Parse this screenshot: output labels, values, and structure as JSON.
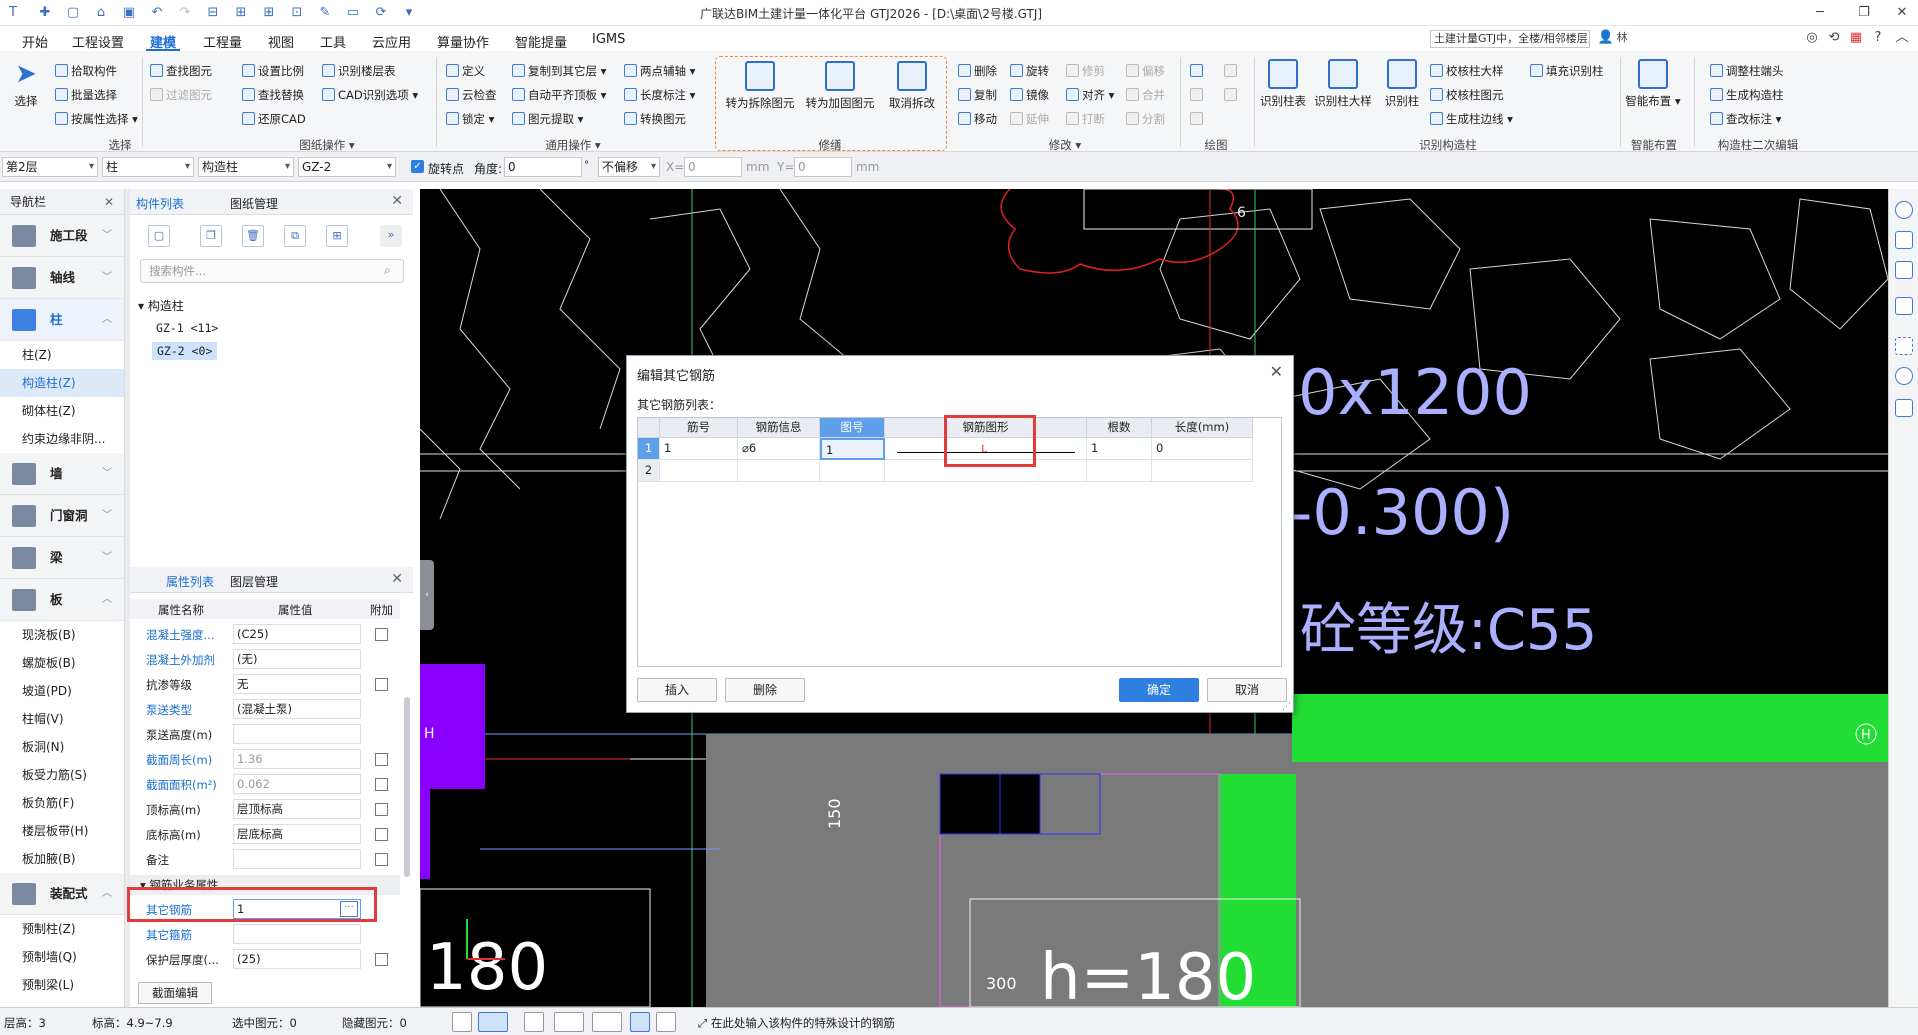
{
  "titlebar": {
    "title": "广联达BIM土建计量一体化平台 GTJ2026 - [D:\\桌面\\2号楼.GTJ]",
    "search_text": "土建计量GTJ中，全楼/相邻楼层三维显示图元/轴网有错",
    "user": "林"
  },
  "menu": {
    "items": [
      "开始",
      "工程设置",
      "建模",
      "工程量",
      "视图",
      "工具",
      "云应用",
      "算量协作",
      "智能提量",
      "IGMS"
    ]
  },
  "ribbon": {
    "select": {
      "big": "选择",
      "items": [
        "拾取构件",
        "批量选择",
        "按属性选择"
      ],
      "group": "选择"
    },
    "drawing_ops": {
      "items": [
        "查找图元",
        "过滤图元",
        "设置比例",
        "查找替换",
        "还原CAD",
        "识别楼层表",
        "CAD识别选项"
      ],
      "group": "图纸操作"
    },
    "common_ops": {
      "items": [
        "定义",
        "云检查",
        "锁定",
        "复制到其它层",
        "自动平齐顶板",
        "图元提取",
        "两点辅轴",
        "长度标注",
        "转换图元"
      ],
      "group": "通用操作"
    },
    "modify_special": {
      "items": [
        "转为拆除图元",
        "转为加固图元",
        "取消拆改"
      ],
      "group": "修缮"
    },
    "modify": {
      "items": [
        "删除",
        "旋转",
        "修剪",
        "偏移",
        "复制",
        "镜像",
        "对齐",
        "合并",
        "移动",
        "延伸",
        "打断",
        "分割"
      ],
      "group": "修改"
    },
    "draw": {
      "group": "绘图"
    },
    "recognize_col": {
      "big": [
        "识别柱表",
        "识别柱大样",
        "识别柱"
      ],
      "items": [
        "校核柱大样",
        "填充识别柱",
        "校核柱图元",
        "生成柱边线"
      ],
      "group": "识别构造柱"
    },
    "smart": {
      "big": "智能布置",
      "group": "智能布置"
    },
    "secondary": {
      "items": [
        "调整柱端头",
        "生成构造柱",
        "查改标注"
      ],
      "group": "构造柱二次编辑"
    }
  },
  "propbar": {
    "floor": "第2层",
    "type": "柱",
    "subtype": "构造柱",
    "comp": "GZ-2",
    "rotate_point": "旋转点",
    "angle_label": "角度:",
    "angle": "0",
    "offset": "不偏移",
    "x_label": "X=",
    "x": "0",
    "y_label": "Y=",
    "y": "0",
    "unit": "mm"
  },
  "nav": {
    "title": "导航栏",
    "categories": [
      {
        "label": "施工段",
        "subs": []
      },
      {
        "label": "轴线",
        "subs": []
      },
      {
        "label": "柱",
        "subs": [
          "柱(Z)",
          "构造柱(Z)",
          "砌体柱(Z)",
          "约束边缘非阴..."
        ]
      },
      {
        "label": "墙",
        "subs": []
      },
      {
        "label": "门窗洞",
        "subs": []
      },
      {
        "label": "梁",
        "subs": []
      },
      {
        "label": "板",
        "subs": [
          "现浇板(B)",
          "螺旋板(B)",
          "坡道(PD)",
          "柱帽(V)",
          "板洞(N)",
          "板受力筋(S)",
          "板负筋(F)",
          "楼层板带(H)",
          "板加腋(B)"
        ]
      },
      {
        "label": "装配式",
        "subs": [
          "预制柱(Z)",
          "预制墙(Q)",
          "预制梁(L)"
        ]
      }
    ]
  },
  "component_panel": {
    "tab1": "构件列表",
    "tab2": "图纸管理",
    "search_placeholder": "搜索构件...",
    "root": "构造柱",
    "items": [
      "GZ-1 <11>",
      "GZ-2 <0>"
    ]
  },
  "property_panel": {
    "tab1": "属性列表",
    "tab2": "图层管理",
    "col_name": "属性名称",
    "col_value": "属性值",
    "col_extra": "附加",
    "rows": [
      {
        "name": "混凝土强度...",
        "value": "(C25)",
        "link": true,
        "check": true
      },
      {
        "name": "混凝土外加剂",
        "value": "(无)",
        "link": true,
        "check": false
      },
      {
        "name": "抗渗等级",
        "value": "无",
        "link": false,
        "check": true
      },
      {
        "name": "泵送类型",
        "value": "(混凝土泵)",
        "link": true,
        "check": false
      },
      {
        "name": "泵送高度(m)",
        "value": "",
        "link": false,
        "check": false
      },
      {
        "name": "截面周长(m)",
        "value": "1.36",
        "link": true,
        "check": true,
        "gray": true
      },
      {
        "name": "截面面积(m²)",
        "value": "0.062",
        "link": true,
        "check": true,
        "gray": true
      },
      {
        "name": "顶标高(m)",
        "value": "层顶标高",
        "link": false,
        "check": true
      },
      {
        "name": "底标高(m)",
        "value": "层底标高",
        "link": false,
        "check": true
      },
      {
        "name": "备注",
        "value": "",
        "link": false,
        "check": true
      }
    ],
    "section": "钢筋业务属性",
    "rows2": [
      {
        "name": "其它钢筋",
        "value": "1",
        "link": true,
        "check": false
      },
      {
        "name": "其它箍筋",
        "value": "",
        "link": true,
        "check": false
      },
      {
        "name": "保护层厚度(...",
        "value": "(25)",
        "link": false,
        "check": true
      }
    ],
    "edit_btn": "截面编辑"
  },
  "dialog": {
    "title": "编辑其它钢筋",
    "subtitle": "其它钢筋列表：",
    "columns": [
      "筋号",
      "钢筋信息",
      "图号",
      "钢筋图形",
      "根数",
      "长度(mm)"
    ],
    "rows": [
      {
        "idx": "1",
        "jin": "1",
        "info": "⌀6",
        "tuhao": "1",
        "shape": "L",
        "count": "1",
        "len": "0"
      },
      {
        "idx": "2",
        "jin": "",
        "info": "",
        "tuhao": "",
        "shape": "",
        "count": "",
        "len": ""
      }
    ],
    "buttons": {
      "insert": "插入",
      "delete": "删除",
      "ok": "确定",
      "cancel": "取消"
    }
  },
  "canvas": {
    "labels": {
      "t1": "6",
      "t2": "0x1200",
      "t3": "-0.300)",
      "t4": "砼等级:C55",
      "t5": "H",
      "t6": "H",
      "t7": "150",
      "t8": "180",
      "t9": "300",
      "t10": "h=180"
    }
  },
  "statusbar": {
    "floor_label": "层高：",
    "floor": "3",
    "elev_label": "标高：",
    "elev": "4.9~7.9",
    "sel_label": "选中图元：",
    "sel": "0",
    "hidden_label": "隐藏图元：",
    "hidden": "0",
    "hint": "在此处输入该构件的特殊设计的钢筋"
  },
  "colors": {
    "accent": "#1a6fd1",
    "highlight_box": "#e23b3b",
    "green": "#22dd33",
    "purple": "#8a00ff"
  }
}
